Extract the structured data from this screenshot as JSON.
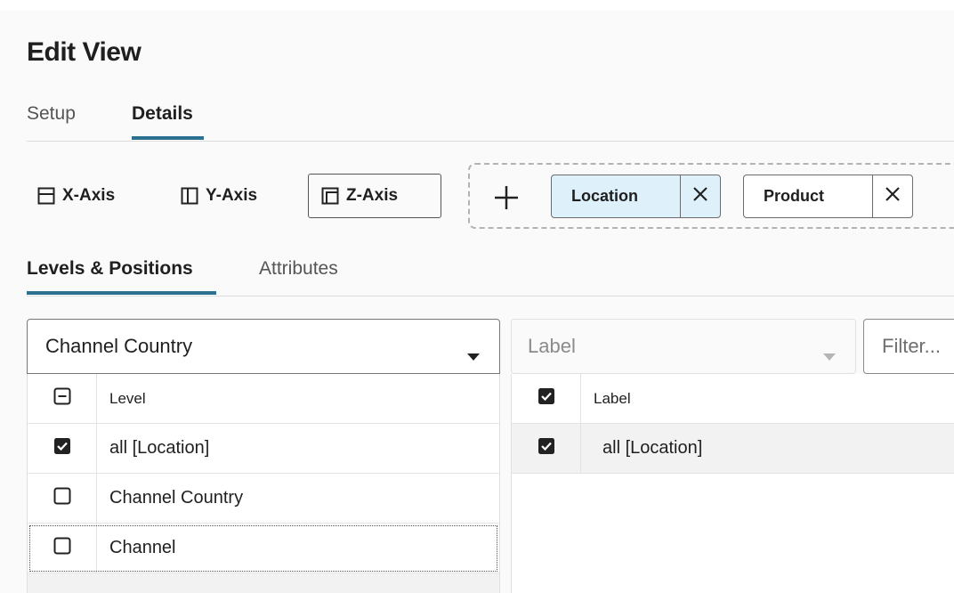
{
  "page": {
    "title": "Edit View"
  },
  "tabs_primary": [
    {
      "label": "Setup",
      "active": false
    },
    {
      "label": "Details",
      "active": true
    }
  ],
  "axes": [
    {
      "label": "X-Axis",
      "icon": "x-axis-icon",
      "selected": false
    },
    {
      "label": "Y-Axis",
      "icon": "y-axis-icon",
      "selected": false
    },
    {
      "label": "Z-Axis",
      "icon": "z-axis-icon",
      "selected": true
    }
  ],
  "dimension_chips": [
    {
      "label": "Location",
      "active": true
    },
    {
      "label": "Product",
      "active": false
    }
  ],
  "tabs_secondary": [
    {
      "label": "Levels & Positions",
      "active": true
    },
    {
      "label": "Attributes",
      "active": false
    }
  ],
  "levels_panel": {
    "selector_value": "Channel Country",
    "header": "Level",
    "rows": [
      {
        "label": "all [Location]",
        "checked": true
      },
      {
        "label": "Channel Country",
        "checked": false
      },
      {
        "label": "Channel",
        "checked": false
      }
    ]
  },
  "positions_panel": {
    "selector_value": "Label",
    "filter_placeholder": "Filter...",
    "header": "Label",
    "rows": [
      {
        "label": "all [Location]",
        "checked": true
      }
    ]
  },
  "colors": {
    "accent": "#2d6f8f",
    "chip_active_bg": "#def1fa"
  }
}
